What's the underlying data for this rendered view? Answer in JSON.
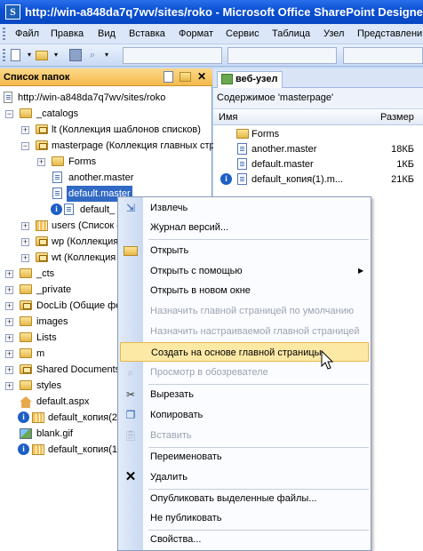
{
  "window": {
    "title": "http://win-a848da7q7wv/sites/roko - Microsoft Office SharePoint Designer"
  },
  "menubar": [
    "Файл",
    "Правка",
    "Вид",
    "Вставка",
    "Формат",
    "Сервис",
    "Таблица",
    "Узел",
    "Представлени"
  ],
  "folder_panel": {
    "title": "Список папок",
    "root": "http://win-a848da7q7wv/sites/roko",
    "items": [
      "_catalogs",
      "lt (Коллекция шаблонов списков)",
      "masterpage (Коллекция главных стр",
      "Forms",
      "another.master",
      "default.master",
      "default_",
      "users (Список с",
      "wp (Коллекция",
      "wt (Коллекция",
      "_cts",
      "_private",
      "DocLib (Общие фот",
      "images",
      "Lists",
      "m",
      "Shared Documents",
      "styles",
      "default.aspx",
      "default_копия(2",
      "blank.gif",
      "default_копия(1"
    ]
  },
  "content_panel": {
    "tab": "веб-узел",
    "subtitle": "Содержимое 'masterpage'",
    "columns": [
      "Имя",
      "Размер"
    ],
    "rows": [
      {
        "name": "Forms",
        "size": ""
      },
      {
        "name": "another.master",
        "size": "18КБ"
      },
      {
        "name": "default.master",
        "size": "1КБ"
      },
      {
        "name": "default_копия(1).m...",
        "size": "21КБ"
      }
    ]
  },
  "context_menu": {
    "items": [
      "Извлечь",
      "Журнал версий...",
      "Открыть",
      "Открыть с помощью",
      "Открыть в новом окне",
      "Назначить главной страницей по умолчанию",
      "Назначить настраиваемой главной страницей",
      "Создать на основе главной страницы",
      "Просмотр в обозревателе",
      "Вырезать",
      "Копировать",
      "Вставить",
      "Переименовать",
      "Удалить",
      "Опубликовать выделенные файлы...",
      "Не публиковать",
      "Свойства..."
    ]
  }
}
